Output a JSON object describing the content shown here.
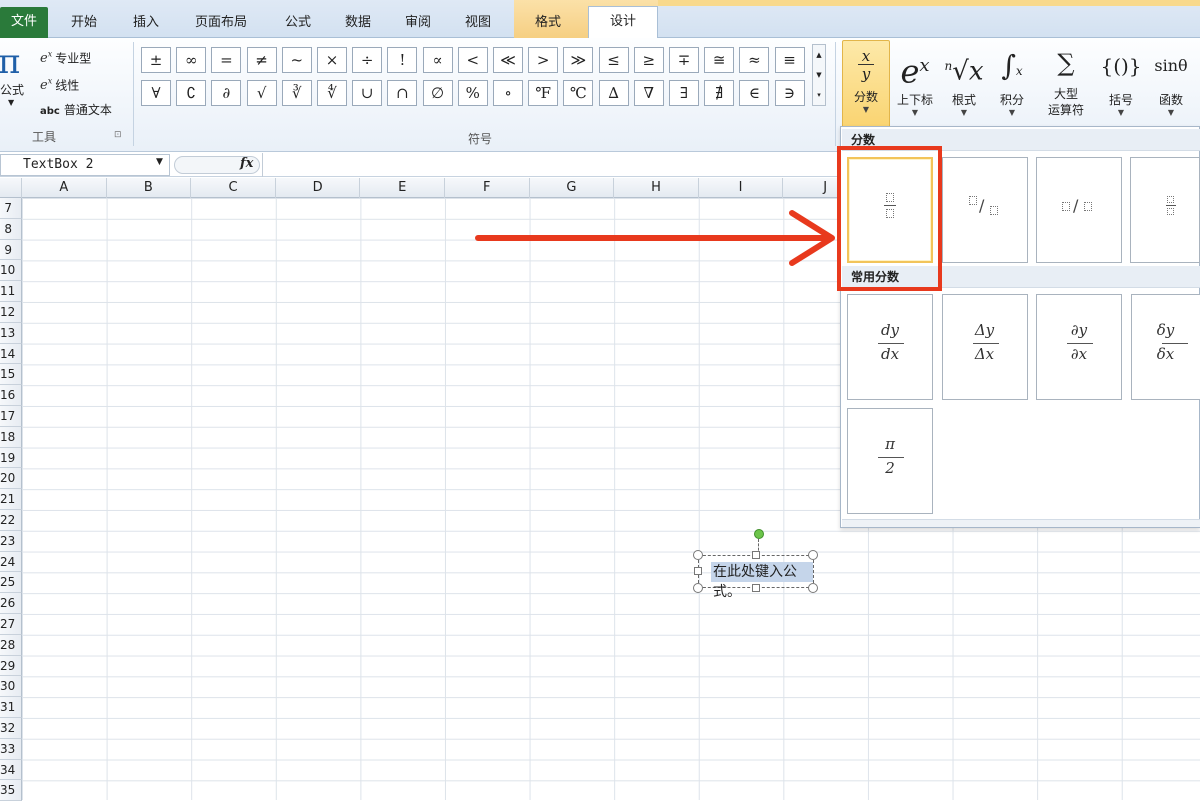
{
  "tabs": [
    {
      "label": "文件"
    },
    {
      "label": "开始"
    },
    {
      "label": "插入"
    },
    {
      "label": "页面布局"
    },
    {
      "label": "公式"
    },
    {
      "label": "数据"
    },
    {
      "label": "审阅"
    },
    {
      "label": "视图"
    },
    {
      "label": "格式"
    },
    {
      "label": "设计"
    }
  ],
  "tools": {
    "equation_label": "公式",
    "professional": "专业型",
    "linear": "线性",
    "normal_text": "普通文本",
    "group_label": "工具"
  },
  "symbols": {
    "row1": [
      "±",
      "∞",
      "=",
      "≠",
      "~",
      "×",
      "÷",
      "!",
      "∝",
      "<",
      "≪",
      ">",
      "≫",
      "≤",
      "≥",
      "∓",
      "≅",
      "≈",
      "≡"
    ],
    "row2": [
      "∀",
      "∁",
      "∂",
      "√",
      "∛",
      "∜",
      "∪",
      "∩",
      "∅",
      "%",
      "∘",
      "℉",
      "℃",
      "∆",
      "∇",
      "∃",
      "∄",
      "∈",
      "∋"
    ],
    "group_label": "符号"
  },
  "structures": [
    {
      "label": "分数",
      "glyph": "x/y"
    },
    {
      "label": "上下标",
      "glyph": "eˣ"
    },
    {
      "label": "根式",
      "glyph": "ⁿ√x"
    },
    {
      "label": "积分",
      "glyph": "∫"
    },
    {
      "label": "大型\n运算符",
      "glyph": "∑"
    },
    {
      "label": "括号",
      "glyph": "{()}"
    },
    {
      "label": "函数",
      "glyph": "sinθ"
    }
  ],
  "formula_bar": {
    "name_box": "TextBox 2",
    "fx": "fx"
  },
  "columns": [
    "A",
    "B",
    "C",
    "D",
    "E",
    "F",
    "G",
    "H",
    "I",
    "J"
  ],
  "rows": [
    "7",
    "8",
    "9",
    "10",
    "11",
    "12",
    "13",
    "14",
    "15",
    "16",
    "17",
    "18",
    "19",
    "20",
    "21",
    "22",
    "23",
    "24",
    "25",
    "26",
    "27",
    "28",
    "29",
    "30",
    "31",
    "32",
    "33",
    "34",
    "35"
  ],
  "gallery": {
    "section1": "分数",
    "section2": "常用分数",
    "common": [
      {
        "num": "dy",
        "den": "dx"
      },
      {
        "num": "Δy",
        "den": "Δx"
      },
      {
        "num": "∂y",
        "den": "∂x"
      },
      {
        "num": "δy",
        "den": "δx"
      },
      {
        "num": "π",
        "den": "2"
      }
    ]
  },
  "equation_box": {
    "placeholder": "在此处键入公式。"
  },
  "colors": {
    "accent_highlight": "#f9d067",
    "annotation_red": "#e8391d",
    "file_tab": "#2a7a3a"
  }
}
